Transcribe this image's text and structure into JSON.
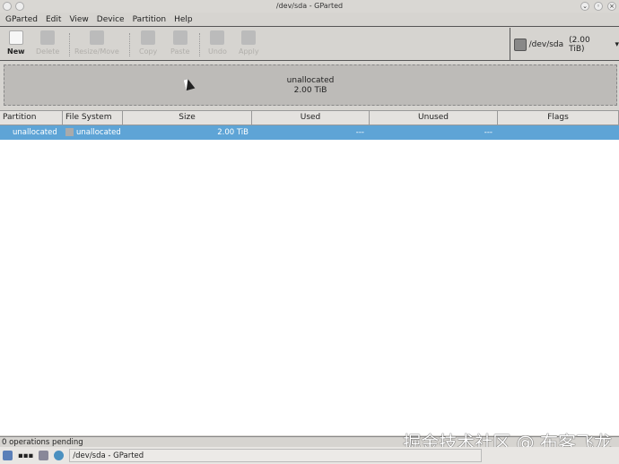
{
  "window": {
    "title": "/dev/sda - GParted"
  },
  "menu": [
    "GParted",
    "Edit",
    "View",
    "Device",
    "Partition",
    "Help"
  ],
  "toolbar": {
    "new": "New",
    "delete": "Delete",
    "resize": "Resize/Move",
    "copy": "Copy",
    "paste": "Paste",
    "undo": "Undo",
    "apply": "Apply"
  },
  "device": {
    "label": "/dev/sda",
    "size": "(2.00 TiB)"
  },
  "map": {
    "name": "unallocated",
    "size": "2.00 TiB"
  },
  "columns": [
    "Partition",
    "File System",
    "Size",
    "Used",
    "Unused",
    "Flags"
  ],
  "rows": [
    {
      "partition": "unallocated",
      "fs": "unallocated",
      "size": "2.00 TiB",
      "used": "---",
      "unused": "---",
      "flags": ""
    }
  ],
  "status": "0 operations pending",
  "taskbar": {
    "task": "/dev/sda - GParted"
  },
  "watermark": "掘金技术社区 @ 布客飞龙"
}
